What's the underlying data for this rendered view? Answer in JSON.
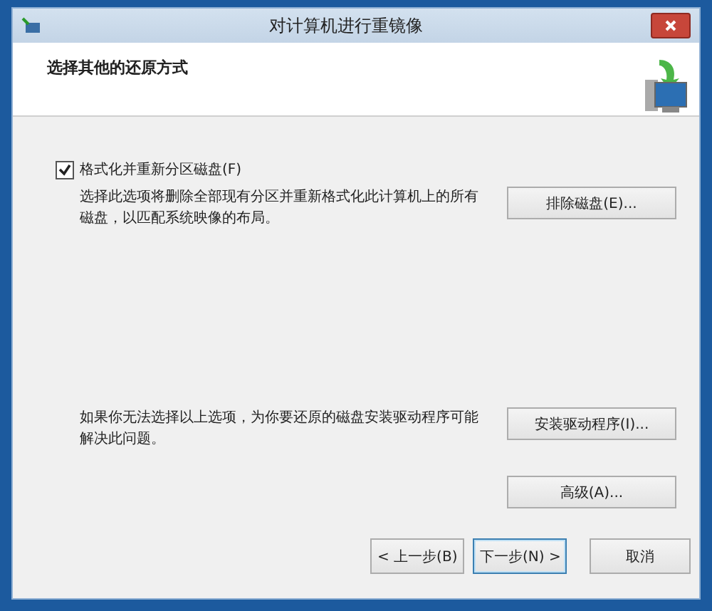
{
  "window": {
    "title": "对计算机进行重镜像"
  },
  "header": {
    "heading": "选择其他的还原方式"
  },
  "options": [
    {
      "kind": "checkbox",
      "label": "格式化并重新分区磁盘(F)",
      "checked": true
    },
    {
      "kind": "text",
      "label": "选择此选项将删除全部现有分区并重新格式化此计算机上的所有磁盘，以匹配系统映像的布局。",
      "button": "排除磁盘(E)..."
    }
  ],
  "driver": {
    "text": "如果你无法选择以上选项，为你要还原的磁盘安装驱动程序可能解决此问题。",
    "button": "安装驱动程序(I)..."
  },
  "advanced_button": "高级(A)...",
  "footer_buttons": [
    {
      "label": "< 上一步(B)",
      "focused": false
    },
    {
      "label": "下一步(N) >",
      "focused": true
    },
    {
      "label": "取消",
      "focused": false
    }
  ]
}
